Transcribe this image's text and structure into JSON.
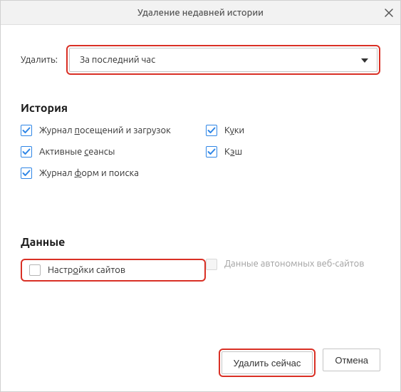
{
  "titlebar": {
    "title": "Удаление недавней истории",
    "close_icon": "close"
  },
  "select": {
    "label": "Удалить:",
    "value": "За последний час"
  },
  "history": {
    "heading": "История",
    "items": {
      "browsing_downloads": {
        "label_pre": "Журнал ",
        "label_u": "п",
        "label_post": "осещений и загрузок",
        "checked": true
      },
      "cookies": {
        "label_pre": "К",
        "label_u": "у",
        "label_post": "ки",
        "checked": true
      },
      "active_sessions": {
        "label_pre": "Активные ",
        "label_u": "с",
        "label_post": "еансы",
        "checked": true
      },
      "cache": {
        "label_pre": "К",
        "label_u": "э",
        "label_post": "ш",
        "checked": true
      },
      "forms_search": {
        "label_pre": "Журнал ",
        "label_u": "ф",
        "label_post": "орм и поиска",
        "checked": true
      }
    }
  },
  "data_section": {
    "heading": "Данные",
    "site_prefs": {
      "label_pre": "Настр",
      "label_u": "о",
      "label_post": "йки сайтов",
      "checked": false
    },
    "offline_data": {
      "label": "Данные автономных веб-сайтов",
      "checked": false,
      "disabled": true
    }
  },
  "footer": {
    "confirm": "Удалить сейчас",
    "cancel": "Отмена"
  },
  "highlight_color": "#d93025"
}
